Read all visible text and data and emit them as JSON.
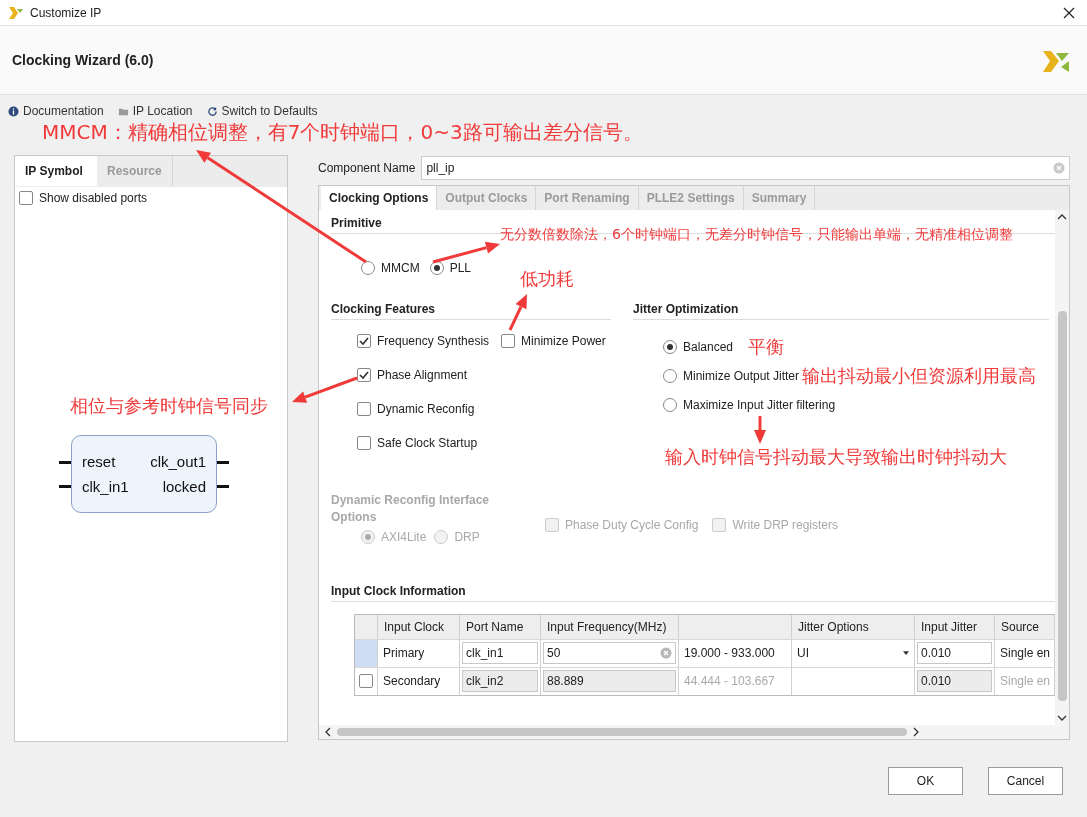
{
  "window": {
    "title": "Customize IP"
  },
  "header": {
    "title": "Clocking Wizard (6.0)"
  },
  "toolbar": [
    {
      "label": "Documentation"
    },
    {
      "label": "IP Location"
    },
    {
      "label": "Switch to Defaults"
    }
  ],
  "left_panel": {
    "tabs": [
      {
        "label": "IP Symbol",
        "selected": true
      },
      {
        "label": "Resource",
        "selected": false
      }
    ],
    "show_disabled_ports": {
      "label": "Show disabled ports",
      "checked": false
    },
    "symbol": {
      "inputs": [
        "reset",
        "clk_in1"
      ],
      "outputs": [
        "clk_out1",
        "locked"
      ]
    }
  },
  "component_name": {
    "label": "Component Name",
    "value": "pll_ip"
  },
  "tabs": [
    {
      "label": "Clocking Options",
      "selected": true
    },
    {
      "label": "Output Clocks",
      "selected": false
    },
    {
      "label": "Port Renaming",
      "selected": false
    },
    {
      "label": "PLLE2 Settings",
      "selected": false
    },
    {
      "label": "Summary",
      "selected": false
    }
  ],
  "primitive": {
    "title": "Primitive",
    "options": [
      {
        "label": "MMCM",
        "selected": false
      },
      {
        "label": "PLL",
        "selected": true
      }
    ]
  },
  "clocking_features": {
    "title": "Clocking Features",
    "rows": [
      [
        {
          "label": "Frequency Synthesis",
          "checked": true
        },
        {
          "label": "Minimize Power",
          "checked": false
        }
      ],
      [
        {
          "label": "Phase Alignment",
          "checked": true
        }
      ],
      [
        {
          "label": "Dynamic Reconfig",
          "checked": false
        }
      ],
      [
        {
          "label": "Safe Clock Startup",
          "checked": false
        }
      ]
    ]
  },
  "jitter_optimization": {
    "title": "Jitter Optimization",
    "options": [
      {
        "label": "Balanced",
        "selected": true
      },
      {
        "label": "Minimize Output Jitter",
        "selected": false
      },
      {
        "label": "Maximize Input Jitter filtering",
        "selected": false
      }
    ]
  },
  "dynamic_reconfig": {
    "title": "Dynamic Reconfig Interface Options",
    "disabled": true,
    "interface": [
      {
        "label": "AXI4Lite",
        "selected": true
      },
      {
        "label": "DRP",
        "selected": false
      }
    ],
    "checkboxes": [
      {
        "label": "Phase Duty Cycle Config",
        "checked": false
      },
      {
        "label": "Write DRP registers",
        "checked": false
      }
    ]
  },
  "input_clock": {
    "title": "Input Clock Information",
    "columns": [
      "Input Clock",
      "Port Name",
      "Input Frequency(MHz)",
      "Jitter Options",
      "Input Jitter",
      "Source"
    ],
    "rows": [
      {
        "kind": "primary",
        "selected": true,
        "name": "Primary",
        "port": "clk_in1",
        "frequency": "50",
        "range": "19.000 - 933.000",
        "jitter_option": "UI",
        "input_jitter": "0.010",
        "source": "Single en",
        "enabled": true
      },
      {
        "kind": "optional",
        "checked": false,
        "name": "Secondary",
        "port": "clk_in2",
        "frequency": "88.889",
        "range": "44.444 - 103.667",
        "input_jitter": "0.010",
        "source": "Single en",
        "enabled": false
      }
    ]
  },
  "buttons": [
    {
      "label": "OK"
    },
    {
      "label": "Cancel"
    }
  ],
  "annotations": [
    "MMCM：精确相位调整，有7个时钟端口，0~3路可输出差分信号。",
    "无分数倍数除法，6个时钟端口，无差分时钟信号，只能输出单端，无精准相位调整",
    "低功耗",
    "相位与参考时钟信号同步",
    "平衡",
    "输出抖动最小但资源利用最高",
    "输入时钟信号抖动最大导致输出时钟抖动大"
  ]
}
